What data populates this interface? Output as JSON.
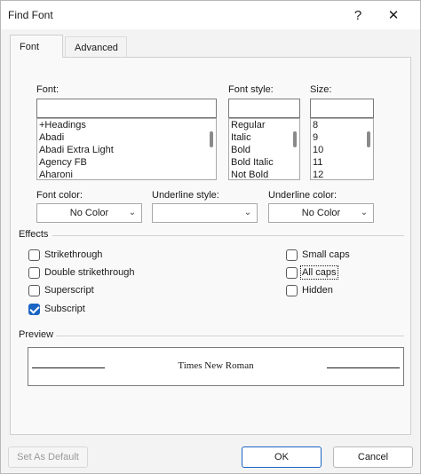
{
  "window": {
    "title": "Find Font",
    "help_glyph": "?",
    "close_glyph": "✕"
  },
  "tabs": [
    {
      "label": "Font"
    },
    {
      "label": "Advanced"
    }
  ],
  "font": {
    "label": "Font:",
    "value": "",
    "items": [
      "+Headings",
      "Abadi",
      "Abadi Extra Light",
      "Agency FB",
      "Aharoni"
    ]
  },
  "font_style": {
    "label": "Font style:",
    "value": "",
    "items": [
      "Regular",
      "Italic",
      "Bold",
      "Bold Italic",
      "Not Bold"
    ]
  },
  "size": {
    "label": "Size:",
    "value": "",
    "items": [
      "8",
      "9",
      "10",
      "11",
      "12"
    ]
  },
  "font_color": {
    "label": "Font color:",
    "value": "No Color"
  },
  "underline_style": {
    "label": "Underline style:",
    "value": ""
  },
  "underline_color": {
    "label": "Underline color:",
    "value": "No Color"
  },
  "effects": {
    "title": "Effects",
    "left": [
      {
        "label": "Strikethrough",
        "checked": false
      },
      {
        "label": "Double strikethrough",
        "checked": false
      },
      {
        "label": "Superscript",
        "checked": false
      },
      {
        "label": "Subscript",
        "checked": true
      }
    ],
    "right": [
      {
        "label": "Small caps",
        "checked": false
      },
      {
        "label": "All caps",
        "checked": false
      },
      {
        "label": "Hidden",
        "checked": false
      }
    ]
  },
  "preview": {
    "title": "Preview",
    "sample": "Times New Roman"
  },
  "buttons": {
    "set_default": "Set As Default",
    "ok": "OK",
    "cancel": "Cancel"
  }
}
